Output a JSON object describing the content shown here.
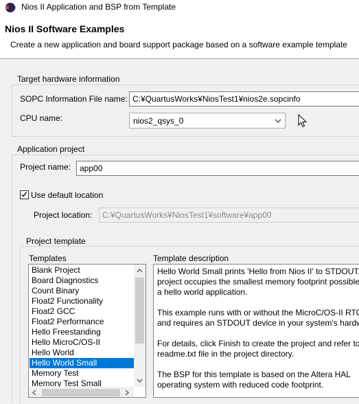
{
  "window": {
    "title": "Nios II Application and BSP from Template",
    "icon": "eclipse-icon"
  },
  "banner": {
    "title": "Nios II Software Examples",
    "description": "Create a new application and board support package based on a software example template"
  },
  "target_hardware": {
    "group_label": "Target hardware information",
    "sopc_label": "SOPC Information File name:",
    "sopc_value": "C:¥QuartusWorks¥NiosTest1¥nios2e.sopcinfo",
    "cpu_label": "CPU name:",
    "cpu_value": "nios2_qsys_0"
  },
  "application_project": {
    "group_label": "Application project",
    "name_label": "Project name:",
    "name_value": "app00",
    "default_location_label": "Use default location",
    "default_location_checked": true,
    "location_label": "Project location:",
    "location_value": "C:¥QuartusWorks¥NiosTest1¥software¥app00"
  },
  "project_template": {
    "group_label": "Project template",
    "templates_label": "Templates",
    "description_label": "Template description",
    "templates": [
      "Blank Project",
      "Board Diagnostics",
      "Count Binary",
      "Float2 Functionality",
      "Float2 GCC",
      "Float2 Performance",
      "Hello Freestanding",
      "Hello MicroC/OS-II",
      "Hello World",
      "Hello World Small",
      "Memory Test",
      "Memory Test Small"
    ],
    "selected_template": "Hello World Small",
    "description_lines": [
      "Hello World Small prints 'Hello from Nios II' to STDOUT.",
      "project occupies the smallest memory footprint possible",
      "a hello world application.",
      "",
      "This example runs with or without the MicroC/OS-II RTO",
      "and requires an STDOUT device in your system's hardwa",
      "",
      "For details, click Finish to create the project and refer to",
      "readme.txt file in the project directory.",
      "",
      "The BSP for this template is based on the Altera HAL",
      "operating system with reduced code footprint."
    ]
  }
}
